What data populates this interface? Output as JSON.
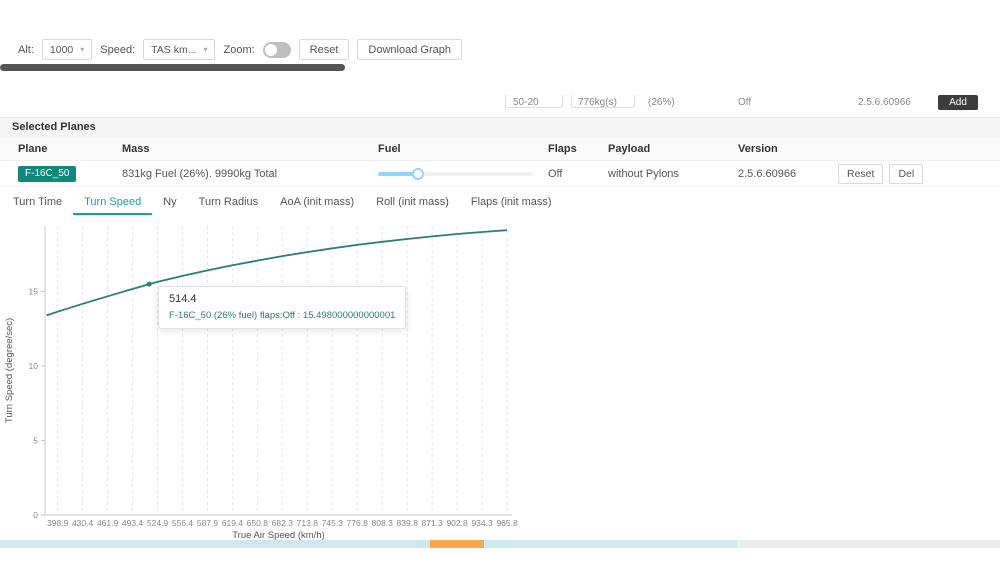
{
  "accent": {
    "teal": "#0f8a7a",
    "line": "#2a7f72",
    "tab_active": "#18a097",
    "slider": "#91d5ff",
    "scroll_blue": "#cde8f0",
    "scroll_orange": "#f8a84b",
    "dark_bar": "#555555"
  },
  "toolbar": {
    "alt_label": "Alt:",
    "alt_value": "1000",
    "speed_label": "Speed:",
    "speed_value": "TAS km...",
    "zoom_label": "Zoom:",
    "reset_label": "Reset",
    "download_label": "Download Graph"
  },
  "clipped_row": {
    "fragments": [
      "50-20",
      "776kg(s)",
      "(26%)",
      "Off",
      "2.5.6.60966"
    ],
    "add_label": "Add"
  },
  "selected_planes": {
    "title": "Selected Planes",
    "columns": [
      "Plane",
      "Mass",
      "Fuel",
      "Flaps",
      "Payload",
      "Version"
    ],
    "row": {
      "plane": "F-16C_50",
      "mass": "831kg Fuel (26%). 9990kg Total",
      "fuel_percent": 26,
      "flaps": "Off",
      "payload": "without Pylons",
      "version": "2.5.6.60966",
      "reset_label": "Reset",
      "del_label": "Del"
    }
  },
  "tabs": [
    {
      "label": "Turn Time"
    },
    {
      "label": "Turn Speed"
    },
    {
      "label": "Ny"
    },
    {
      "label": "Turn Radius"
    },
    {
      "label": "AoA (init mass)"
    },
    {
      "label": "Roll (init mass)"
    },
    {
      "label": "Flaps (init mass)"
    }
  ],
  "active_tab": "Turn Speed",
  "chart_data": {
    "type": "line",
    "title": "",
    "xlabel": "True Air Speed (km/h)",
    "ylabel": "Turn Speed (degree/sec)",
    "xlim": [
      383,
      972
    ],
    "ylim": [
      0,
      19.4
    ],
    "grid": "vertical-dashed",
    "legend": "none",
    "x_ticks": [
      398.9,
      430.4,
      461.9,
      493.4,
      524.9,
      556.4,
      587.9,
      619.4,
      650.8,
      682.3,
      713.8,
      745.3,
      776.8,
      808.3,
      839.8,
      871.3,
      902.8,
      934.3,
      965.8
    ],
    "y_ticks": [
      0,
      5,
      10,
      15
    ],
    "series": [
      {
        "name": "F-16C_50 (26% fuel) flaps:Off",
        "color": "#2a7f72",
        "points": [
          [
            385,
            13.4
          ],
          [
            398.9,
            13.65
          ],
          [
            430.4,
            14.18
          ],
          [
            461.9,
            14.68
          ],
          [
            493.4,
            15.17
          ],
          [
            514.4,
            15.498
          ],
          [
            524.9,
            15.65
          ],
          [
            556.4,
            16.05
          ],
          [
            587.9,
            16.42
          ],
          [
            619.4,
            16.77
          ],
          [
            650.8,
            17.08
          ],
          [
            682.3,
            17.38
          ],
          [
            713.8,
            17.65
          ],
          [
            745.3,
            17.9
          ],
          [
            776.8,
            18.13
          ],
          [
            808.3,
            18.34
          ],
          [
            839.8,
            18.53
          ],
          [
            871.3,
            18.7
          ],
          [
            902.8,
            18.86
          ],
          [
            934.3,
            19.0
          ],
          [
            965.8,
            19.12
          ]
        ]
      }
    ],
    "marker": {
      "x": 514.4,
      "y": 15.498
    },
    "tooltip": {
      "title": "514.4",
      "line": "F-16C_50 (26% fuel) flaps:Off : 15.498000000000001"
    }
  }
}
